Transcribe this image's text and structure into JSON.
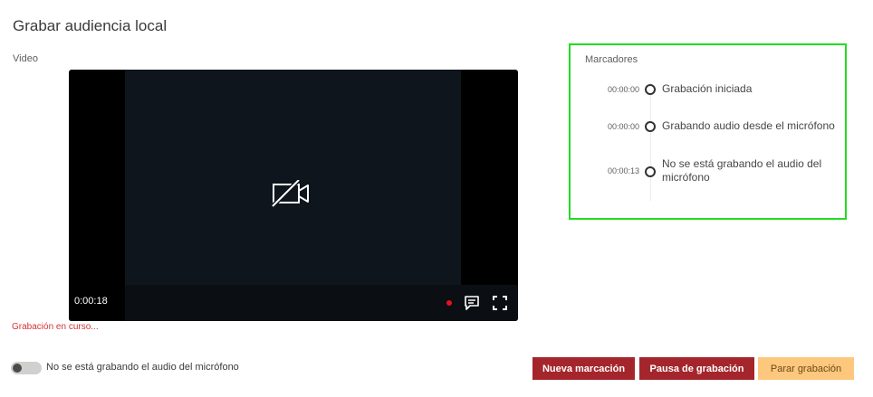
{
  "page": {
    "title": "Grabar audiencia local"
  },
  "video": {
    "label": "Video",
    "elapsed": "0:00:18",
    "status": "Grabación en curso..."
  },
  "markers": {
    "title": "Marcadores",
    "items": [
      {
        "time": "00:00:00",
        "text": "Grabación iniciada"
      },
      {
        "time": "00:00:00",
        "text": "Grabando audio desde el micrófono"
      },
      {
        "time": "00:00:13",
        "text": "No se está grabando el audio del micrófono"
      }
    ]
  },
  "microphone": {
    "toggle_label": "No se está grabando el audio del micrófono",
    "enabled": false
  },
  "actions": {
    "new_marker": "Nueva marcación",
    "pause": "Pausa de grabación",
    "stop": "Parar grabación"
  },
  "colors": {
    "primary": "#a4262c",
    "stop": "#fdc77d",
    "recording": "#e81123",
    "highlight_border": "#22dd22"
  },
  "icons": [
    "camera-off-icon",
    "chat-icon",
    "fullscreen-icon"
  ]
}
